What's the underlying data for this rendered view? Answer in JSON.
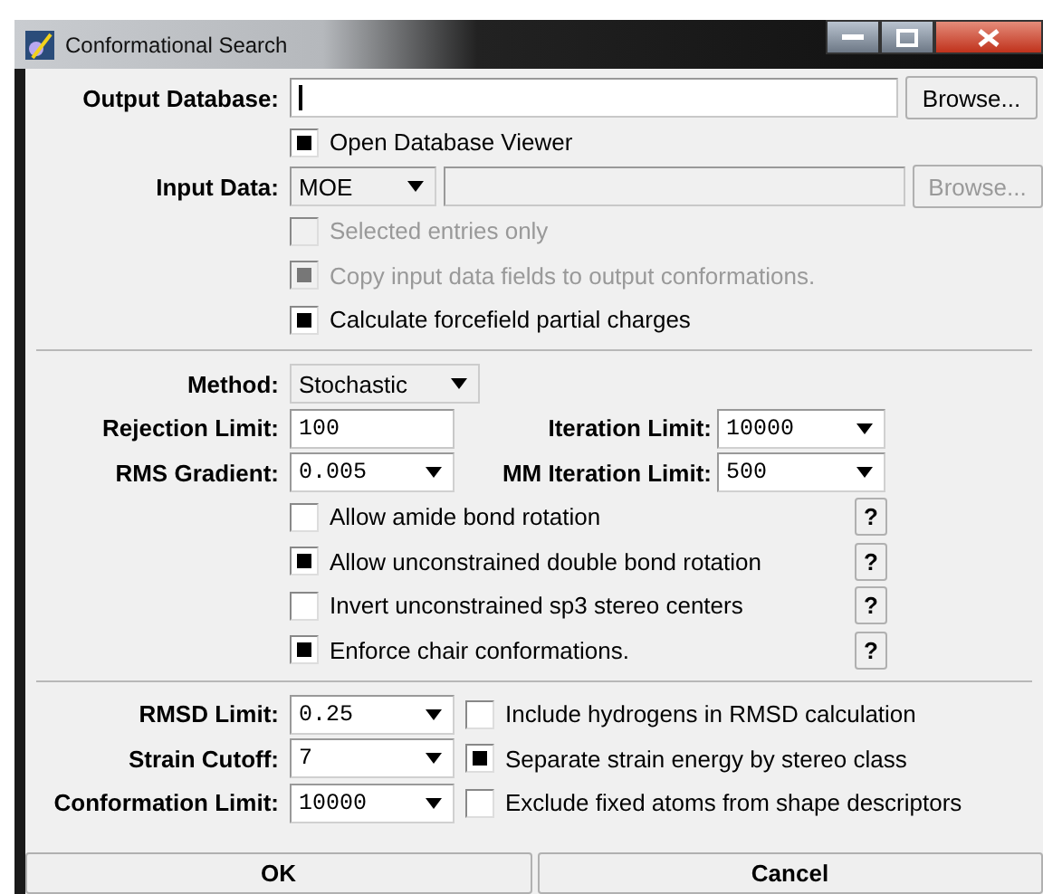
{
  "window": {
    "title": "Conformational Search"
  },
  "section_1": {
    "output": {
      "label": "Output Database:",
      "focused": true,
      "browse": "Browse..."
    },
    "open_viewer": {
      "label": "Open Database Viewer",
      "checked": true,
      "disabled": false
    },
    "input": {
      "label": "Input Data:",
      "select": "MOE",
      "disabled": true,
      "browse": "Browse..."
    },
    "options": [
      {
        "label": "Selected entries only",
        "checked": false,
        "disabled": true
      },
      {
        "label": "Copy input data fields to output conformations.",
        "checked": true,
        "disabled": true
      },
      {
        "label": "Calculate forcefield partial charges",
        "checked": true,
        "disabled": false
      }
    ]
  },
  "section_2": {
    "method": {
      "label": "Method:",
      "value": "Stochastic"
    },
    "pairs": [
      [
        {
          "kind": "text",
          "label": "Rejection Limit:",
          "value": "100"
        },
        {
          "kind": "select",
          "label": "Iteration Limit:",
          "value": "10000"
        }
      ],
      [
        {
          "kind": "select",
          "label": "RMS Gradient:",
          "value": "0.005"
        },
        {
          "kind": "select",
          "label": "MM Iteration Limit:",
          "value": "500"
        }
      ]
    ],
    "options": [
      {
        "label": "Allow amide bond rotation",
        "checked": false,
        "help": "?"
      },
      {
        "label": "Allow unconstrained double bond rotation",
        "checked": true,
        "help": "?"
      },
      {
        "label": "Invert unconstrained sp3 stereo centers",
        "checked": false,
        "help": "?"
      },
      {
        "label": "Enforce chair conformations.",
        "checked": true,
        "help": "?"
      }
    ]
  },
  "section_3": [
    {
      "label": "RMSD Limit:",
      "value": "0.25",
      "option": "Include hydrogens in RMSD calculation",
      "checked": false
    },
    {
      "label": "Strain Cutoff:",
      "value": "7",
      "option": "Separate strain energy by stereo class",
      "checked": true
    },
    {
      "label": "Conformation Limit:",
      "value": "10000",
      "option": "Exclude fixed atoms from shape descriptors",
      "checked": false
    }
  ],
  "buttons": [
    "OK",
    "Cancel"
  ]
}
